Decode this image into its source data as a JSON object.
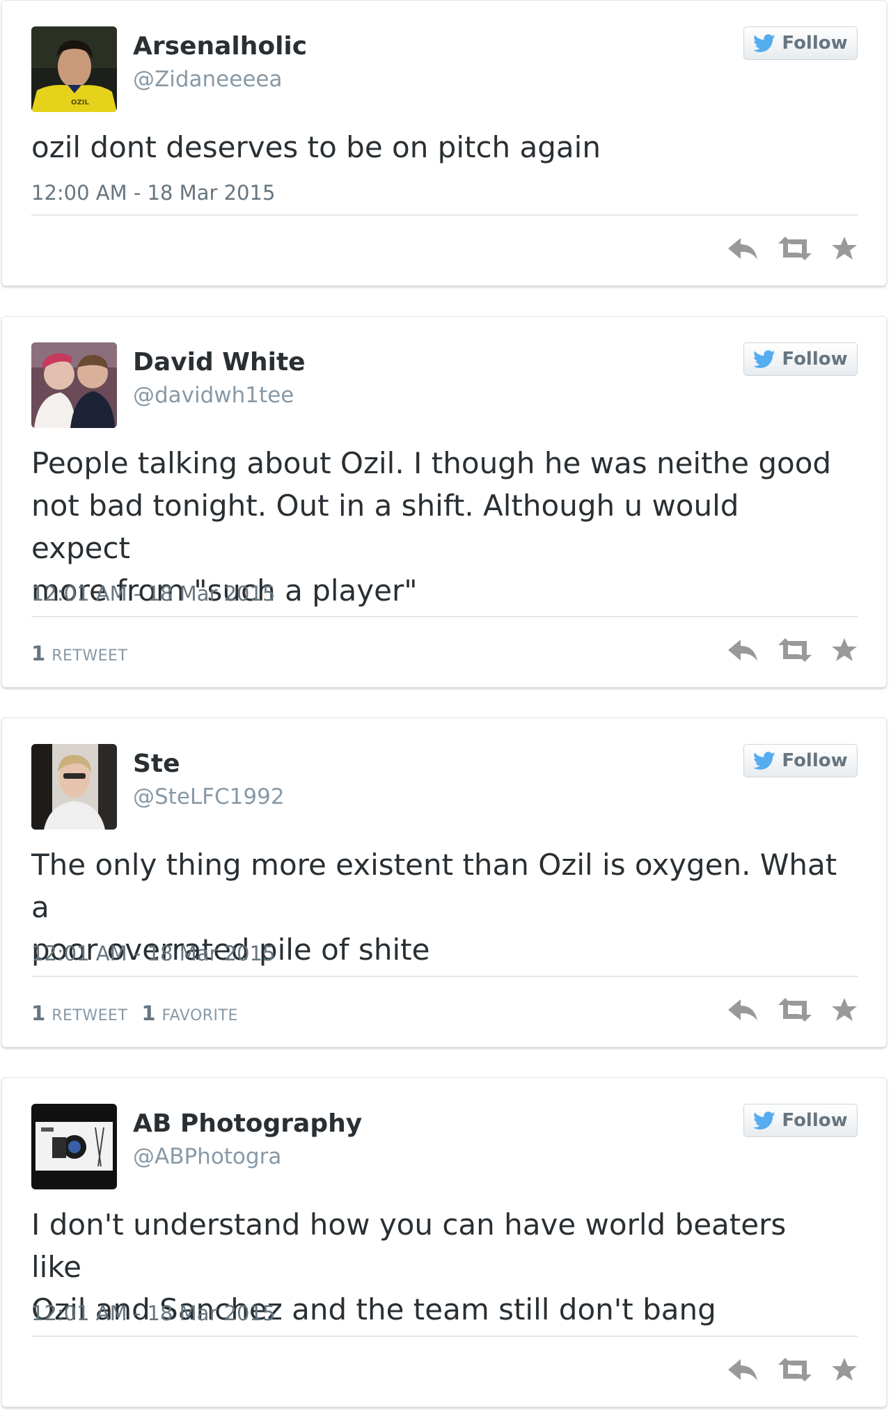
{
  "tweets": [
    {
      "name": "Arsenalholic",
      "handle": "@Zidaneeeea",
      "text": "ozil dont deserves to be on pitch again",
      "timestamp": "12:00 AM - 18 Mar 2015",
      "follow_label": "Follow",
      "avatar_shirt_text": "OZIL",
      "stats": []
    },
    {
      "name": "David White",
      "handle": "@davidwh1tee",
      "text": "People talking about Ozil. I though he was neithe good\nnot bad tonight. Out in a shift. Although u would expect\nmore from \"such a player\"",
      "timestamp": "12:01 AM - 18 Mar 2015",
      "follow_label": "Follow",
      "stats": [
        {
          "count": "1",
          "label": "RETWEET"
        }
      ]
    },
    {
      "name": "Ste",
      "handle": "@SteLFC1992",
      "text": "The only thing more existent than Ozil is oxygen. What a\npoor overrated pile of shite",
      "timestamp": "12:01 AM - 18 Mar 2015",
      "follow_label": "Follow",
      "stats": [
        {
          "count": "1",
          "label": "RETWEET"
        },
        {
          "count": "1",
          "label": "FAVORITE"
        }
      ]
    },
    {
      "name": "AB Photography",
      "handle": "@ABPhotogra",
      "text": "I don't understand how you can have world beaters like\nOzil and Sanchez and the team still don't bang",
      "timestamp": "12:01 AM - 18 Mar 2015",
      "follow_label": "Follow",
      "stats": []
    }
  ],
  "icons": {
    "follow": "twitter-bird-icon",
    "reply": "reply-icon",
    "retweet": "retweet-icon",
    "favorite": "star-icon"
  },
  "colors": {
    "twitter_blue": "#55acee",
    "action_gray": "#999999",
    "meta_gray": "#66757f",
    "name_text": "#292f33"
  }
}
